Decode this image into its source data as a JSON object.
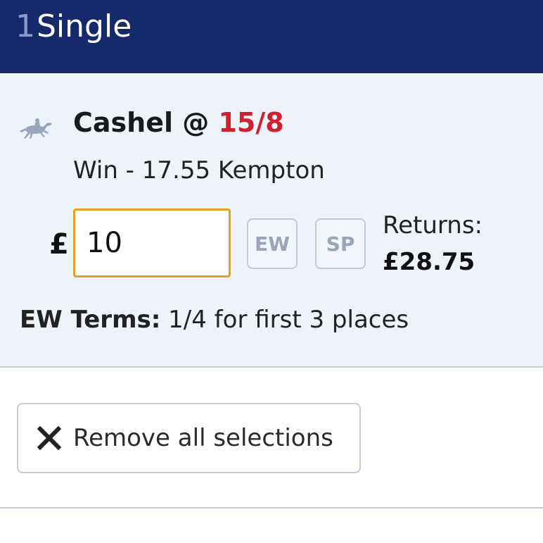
{
  "header": {
    "count": "1",
    "title": "Single"
  },
  "bet": {
    "sport_icon": "horse-racing-icon",
    "selection_name": "Cashel",
    "at_symbol": "@",
    "odds": "15/8",
    "market": "Win - 17.55 Kempton",
    "currency_symbol": "£",
    "stake_value": "10",
    "ew_label": "EW",
    "sp_label": "SP",
    "returns_label": "Returns:",
    "returns_value": "£28.75",
    "ew_terms_label": "EW Terms:",
    "ew_terms_value": "1/4 for first 3 places"
  },
  "actions": {
    "remove_icon": "close-icon",
    "remove_label": "Remove all selections"
  },
  "colors": {
    "header_bg": "#142a6b",
    "panel_bg": "#eef2f9",
    "odds": "#d0202e",
    "input_focus_border": "#e0a31e"
  }
}
